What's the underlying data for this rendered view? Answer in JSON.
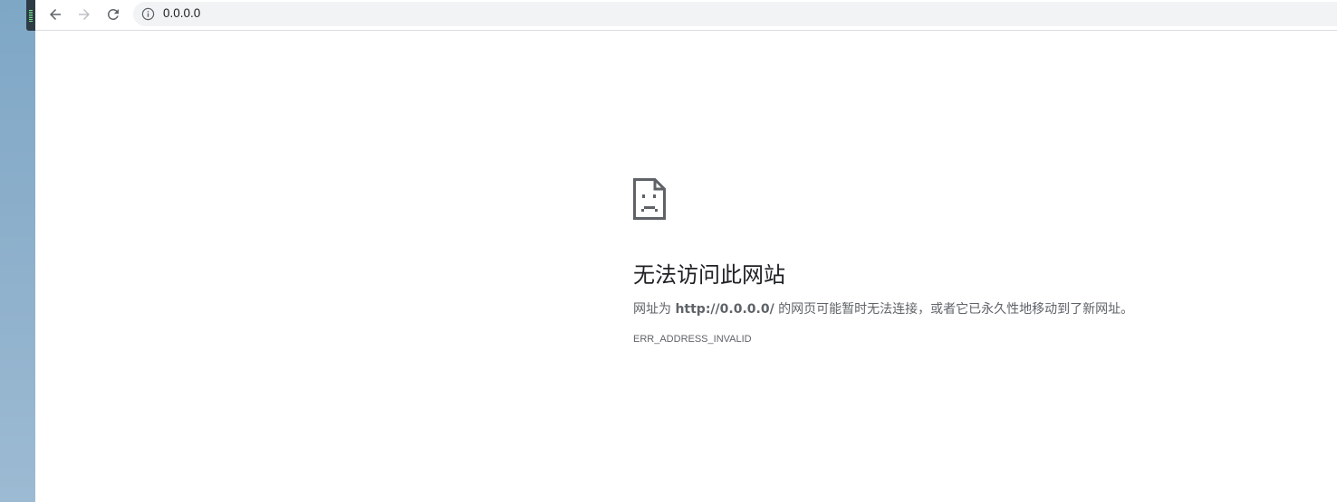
{
  "browser": {
    "address_bar": {
      "url": "0.0.0.0",
      "info_icon": "info-icon"
    },
    "nav": {
      "back_icon": "back-arrow-icon",
      "forward_icon": "forward-arrow-icon",
      "reload_icon": "reload-icon",
      "forward_enabled": false
    }
  },
  "error_page": {
    "icon": "sad-file-icon",
    "title": "无法访问此网站",
    "description_prefix": "网址为 ",
    "description_url": "http://0.0.0.0/",
    "description_suffix": " 的网页可能暂时无法连接，或者它已永久性地移动到了新网址。",
    "error_code": "ERR_ADDRESS_INVALID"
  },
  "colors": {
    "text_primary": "#202124",
    "text_secondary": "#5f6368",
    "omnibox_bg": "#f1f3f4",
    "desktop_bg": "#8fb1cc"
  }
}
